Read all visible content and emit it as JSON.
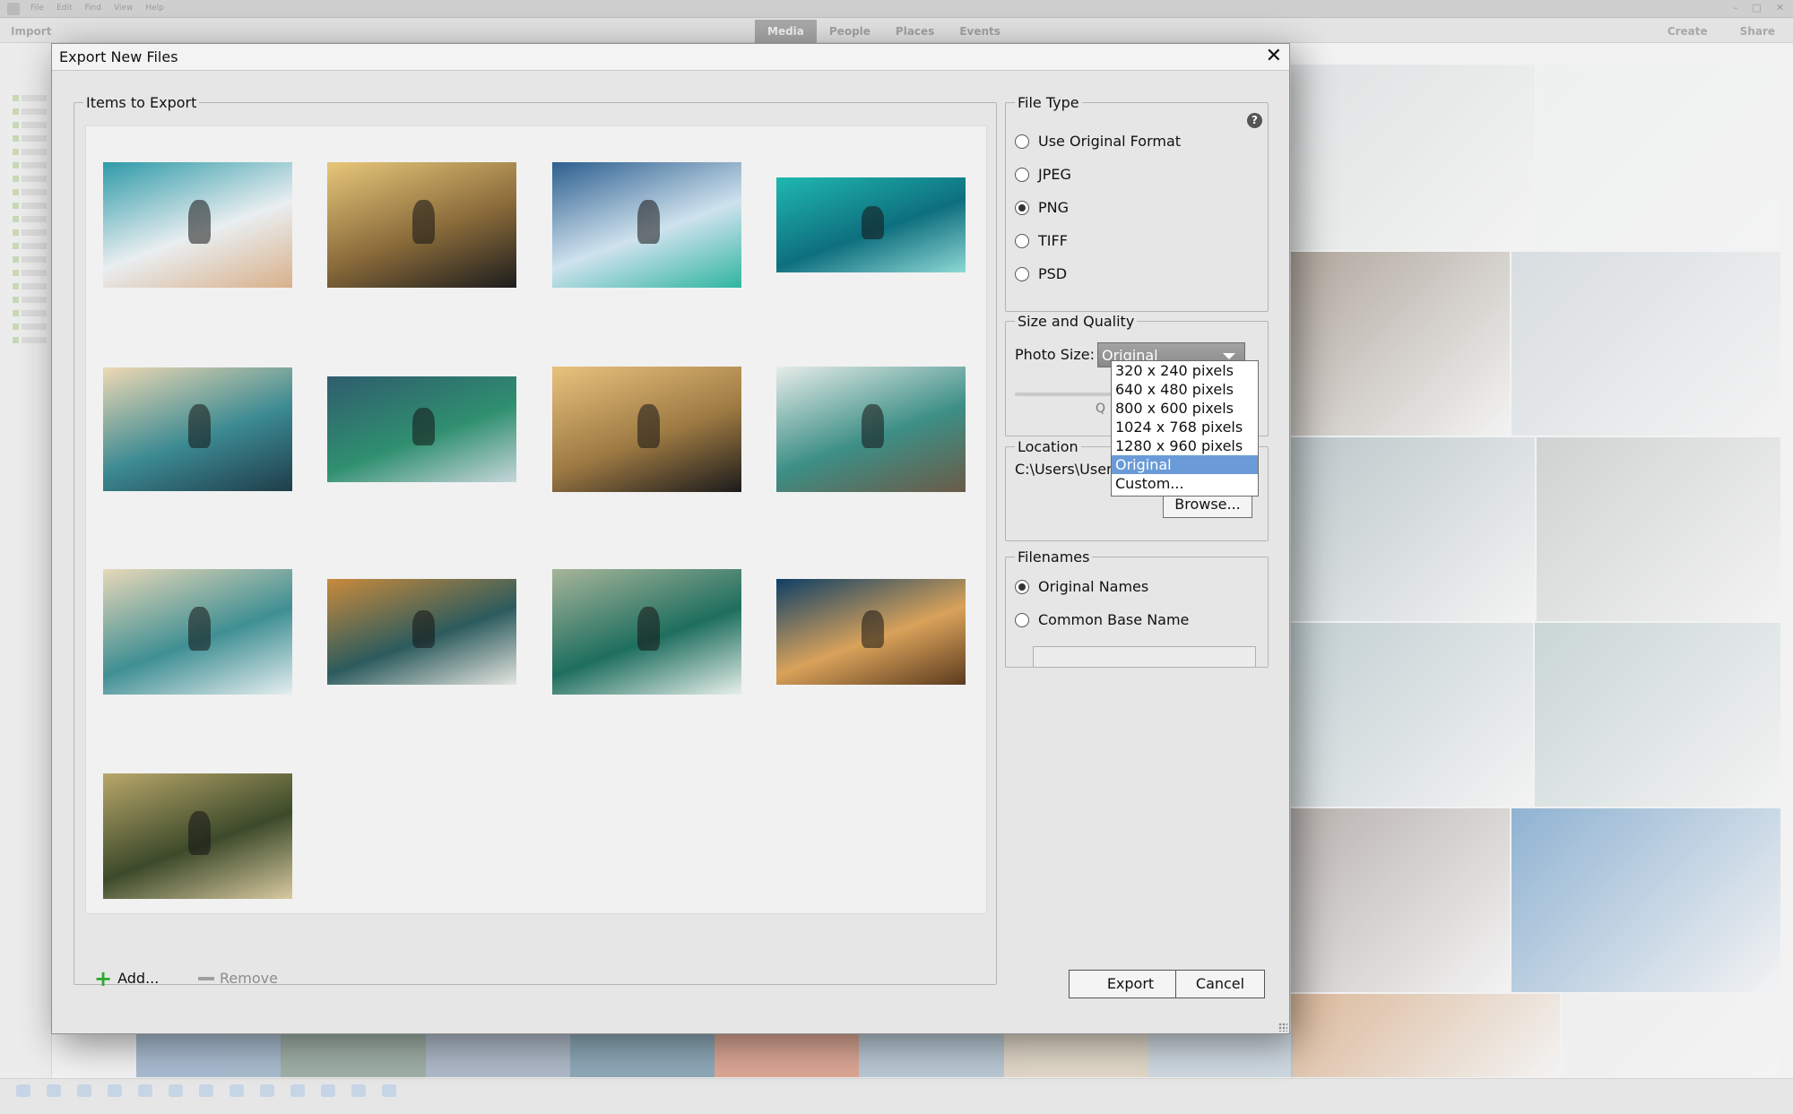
{
  "background_app": {
    "menus": [
      "File",
      "Edit",
      "Find",
      "View",
      "Help"
    ],
    "import_label": "Import",
    "tabs": [
      {
        "label": "Media",
        "active": true
      },
      {
        "label": "People",
        "active": false
      },
      {
        "label": "Places",
        "active": false
      },
      {
        "label": "Events",
        "active": false
      }
    ],
    "right_buttons": [
      "Create",
      "Share"
    ]
  },
  "dialog": {
    "title": "Export New Files",
    "items_group": {
      "legend": "Items to Export",
      "add_label": "Add...",
      "remove_label": "Remove",
      "thumbnails": [
        {
          "c1": "#2e9aa8",
          "c2": "#e9eef0",
          "c3": "#d8b08a"
        },
        {
          "c1": "#e7c77a",
          "c2": "#8a6b3a",
          "c3": "#1d1d1d"
        },
        {
          "c1": "#2d5f8f",
          "c2": "#cfe2ee",
          "c3": "#2fb5a0"
        },
        {
          "c1": "#1fb8b0",
          "c2": "#0e6f7e",
          "c3": "#8ed8d4"
        },
        {
          "c1": "#eed9b4",
          "c2": "#3c8a92",
          "c3": "#1f3d4a"
        },
        {
          "c1": "#2f5d6e",
          "c2": "#2f8f6f",
          "c3": "#c7d6da"
        },
        {
          "c1": "#e9c27e",
          "c2": "#9e7a43",
          "c3": "#1b1b1b"
        },
        {
          "c1": "#e6ece9",
          "c2": "#3d8f86",
          "c3": "#6b5b47"
        },
        {
          "c1": "#e8d8b8",
          "c2": "#3f8f93",
          "c3": "#e6eef0"
        },
        {
          "c1": "#c98a3c",
          "c2": "#2c5b5d",
          "c3": "#e6e6e0"
        },
        {
          "c1": "#a7b59a",
          "c2": "#1e6e5e",
          "c3": "#e7f0ea"
        },
        {
          "c1": "#0f3f66",
          "c2": "#d9a25a",
          "c3": "#5b3b1e"
        },
        {
          "c1": "#b9a76a",
          "c2": "#3c4a2a",
          "c3": "#d8c9a0"
        }
      ]
    },
    "file_type": {
      "legend": "File Type",
      "options": [
        {
          "label": "Use Original Format",
          "checked": false
        },
        {
          "label": "JPEG",
          "checked": false
        },
        {
          "label": "PNG",
          "checked": true
        },
        {
          "label": "TIFF",
          "checked": false
        },
        {
          "label": "PSD",
          "checked": false
        }
      ]
    },
    "size_quality": {
      "legend": "Size and Quality",
      "photo_size_label": "Photo Size:",
      "selected_size": "Original",
      "quality_label": "Q",
      "size_options": [
        {
          "label": "320 x 240 pixels",
          "selected": false
        },
        {
          "label": "640 x 480 pixels",
          "selected": false
        },
        {
          "label": "800 x 600 pixels",
          "selected": false
        },
        {
          "label": "1024 x 768 pixels",
          "selected": false
        },
        {
          "label": "1280 x 960 pixels",
          "selected": false
        },
        {
          "label": "Original",
          "selected": true
        },
        {
          "label": "Custom...",
          "selected": false
        }
      ]
    },
    "location": {
      "legend": "Location",
      "path": "C:\\Users\\User",
      "browse_label": "Browse..."
    },
    "filenames": {
      "legend": "Filenames",
      "options": [
        {
          "label": "Original Names",
          "checked": true
        },
        {
          "label": "Common Base Name",
          "checked": false
        }
      ],
      "base_name_value": ""
    },
    "export_label": "Export",
    "cancel_label": "Cancel"
  },
  "colors": {
    "selection": "#6a9bd8",
    "add_icon": "#2ea82e",
    "select_bg": "#8a8a8a"
  }
}
